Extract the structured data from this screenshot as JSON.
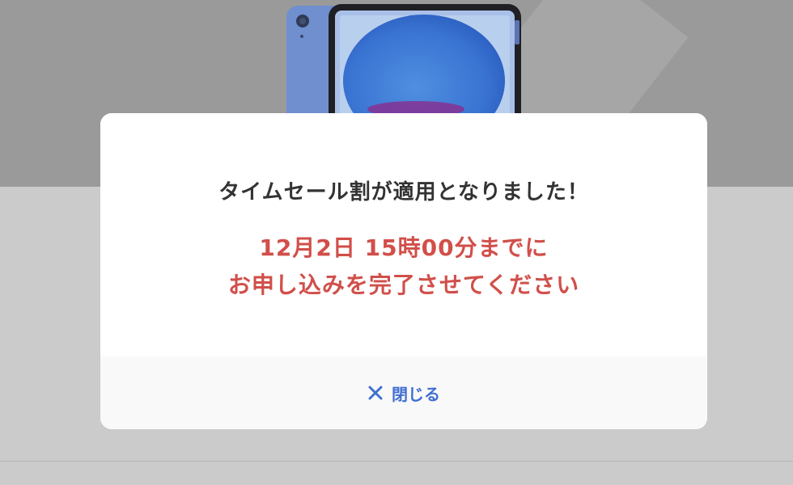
{
  "banner": {
    "product_image": "tablet-image",
    "background_color": "#9a9a9a"
  },
  "modal": {
    "title": "タイムセール割が適用となりました！",
    "deadline_line1": "12月2日 15時00分までに",
    "deadline_line2": "お申し込みを完了させてください",
    "close_label": "閉じる",
    "close_icon": "close-icon",
    "accent_color": "#3f6fd1",
    "alert_color": "#d14f4a"
  }
}
